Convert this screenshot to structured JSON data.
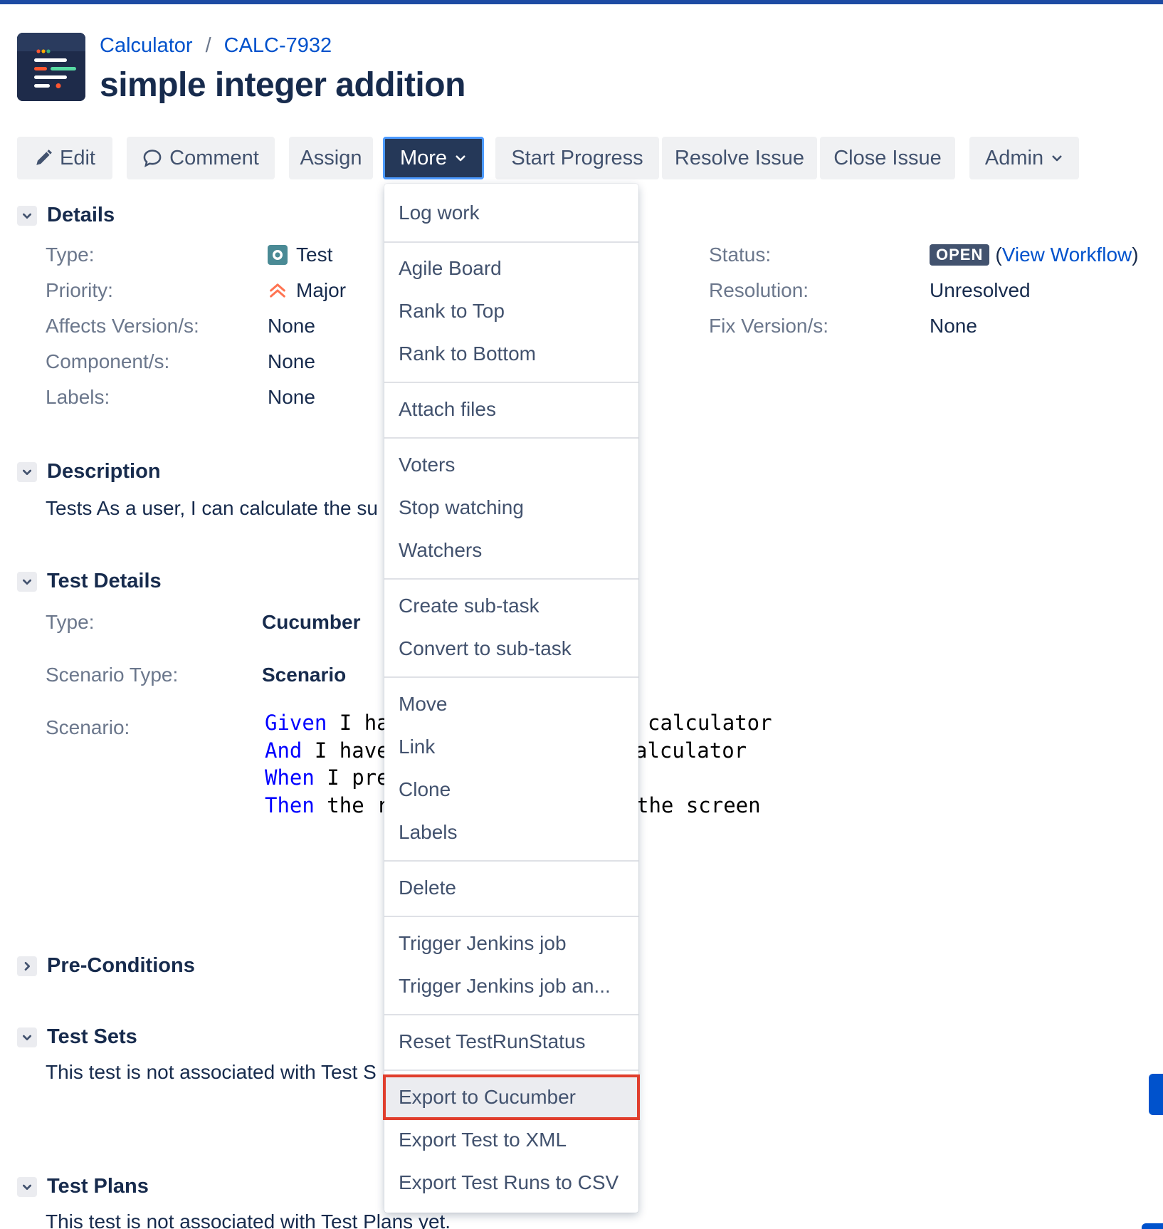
{
  "breadcrumb": {
    "project": "Calculator",
    "separator": "/",
    "issue_key": "CALC-7932"
  },
  "issue": {
    "title": "simple integer addition"
  },
  "toolbar": {
    "edit": "Edit",
    "comment": "Comment",
    "assign": "Assign",
    "more": "More",
    "start_progress": "Start Progress",
    "resolve_issue": "Resolve Issue",
    "close_issue": "Close Issue",
    "admin": "Admin"
  },
  "details": {
    "heading": "Details",
    "type_label": "Type:",
    "type_value": "Test",
    "priority_label": "Priority:",
    "priority_value": "Major",
    "affects_label": "Affects Version/s:",
    "affects_value": "None",
    "components_label": "Component/s:",
    "components_value": "None",
    "labels_label": "Labels:",
    "labels_value": "None",
    "status_label": "Status:",
    "status_value": "OPEN",
    "view_workflow_open": "(",
    "view_workflow": "View Workflow",
    "view_workflow_close": ")",
    "resolution_label": "Resolution:",
    "resolution_value": "Unresolved",
    "fix_label": "Fix Version/s:",
    "fix_value": "None"
  },
  "description": {
    "heading": "Description",
    "text": "Tests As a user, I can calculate the su"
  },
  "test_details": {
    "heading": "Test Details",
    "type_label": "Type:",
    "type_value": "Cucumber",
    "scenario_type_label": "Scenario Type:",
    "scenario_type_value": "Scenario",
    "scenario_label": "Scenario:",
    "scenario_lines": [
      {
        "keyword": "Given",
        "text": " I ha",
        "tail": "calculator"
      },
      {
        "keyword": "And",
        "text": " I have",
        "tail": "alculator"
      },
      {
        "keyword": "When",
        "text": " I pre",
        "tail": ""
      },
      {
        "keyword": "Then",
        "text": " the r",
        "tail": "the screen"
      }
    ]
  },
  "pre_conditions": {
    "heading": "Pre-Conditions"
  },
  "test_sets": {
    "heading": "Test Sets",
    "text": "This test is not associated with Test S"
  },
  "test_plans": {
    "heading": "Test Plans",
    "text": "This test is not associated with Test Plans yet."
  },
  "more_menu": {
    "items": [
      "Log work",
      "Agile Board",
      "Rank to Top",
      "Rank to Bottom",
      "Attach files",
      "Voters",
      "Stop watching",
      "Watchers",
      "Create sub-task",
      "Convert to sub-task",
      "Move",
      "Link",
      "Clone",
      "Labels",
      "Delete",
      "Trigger Jenkins job",
      "Trigger Jenkins job an...",
      "Reset TestRunStatus",
      "Export to Cucumber",
      "Export Test to XML",
      "Export Test Runs to CSV"
    ],
    "highlighted": "Export to Cucumber"
  },
  "colors": {
    "link": "#0052cc",
    "primary_text": "#172b4d",
    "label_text": "#6b778c",
    "active_button": "#253858",
    "highlight_outline": "#e03e2d",
    "gherkin_keyword": "#0000ff"
  }
}
